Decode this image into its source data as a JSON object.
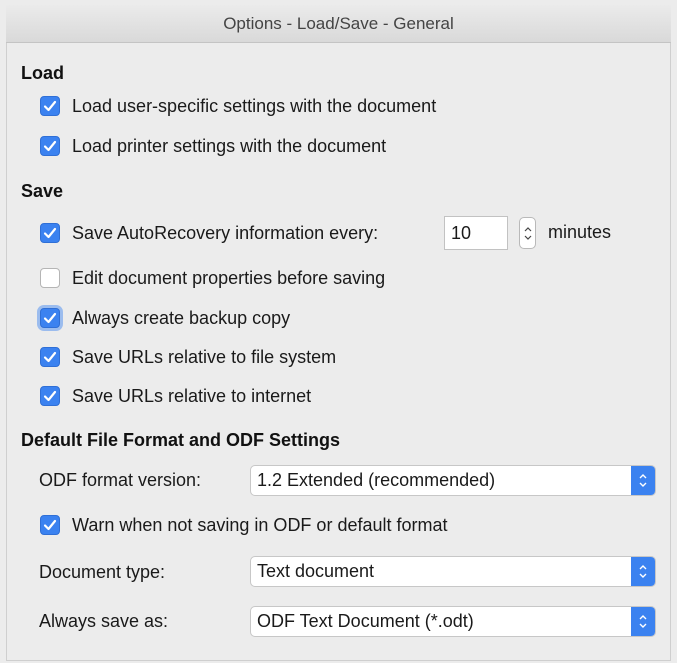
{
  "window": {
    "title": "Options - Load/Save - General"
  },
  "load": {
    "heading": "Load",
    "items": [
      {
        "label": "Load user-specific settings with the document",
        "checked": true
      },
      {
        "label": "Load printer settings with the document",
        "checked": true
      }
    ]
  },
  "save": {
    "heading": "Save",
    "autorecovery": {
      "label": "Save AutoRecovery information every:",
      "checked": true,
      "value": "10",
      "unit": "minutes"
    },
    "items": [
      {
        "label": "Edit document properties before saving",
        "checked": false
      },
      {
        "label": "Always create backup copy",
        "checked": true
      },
      {
        "label": "Save URLs relative to file system",
        "checked": true
      },
      {
        "label": "Save URLs relative to internet",
        "checked": true
      }
    ]
  },
  "format": {
    "heading": "Default File Format and ODF Settings",
    "odf_version": {
      "label": "ODF format version:",
      "value": "1.2 Extended (recommended)"
    },
    "warn": {
      "label": "Warn when not saving in ODF or default format",
      "checked": true
    },
    "doc_type": {
      "label": "Document type:",
      "value": "Text document"
    },
    "save_as": {
      "label": "Always save as:",
      "value": "ODF Text Document (*.odt)"
    }
  },
  "colors": {
    "accent": "#3b82f0",
    "background": "#ececec"
  }
}
